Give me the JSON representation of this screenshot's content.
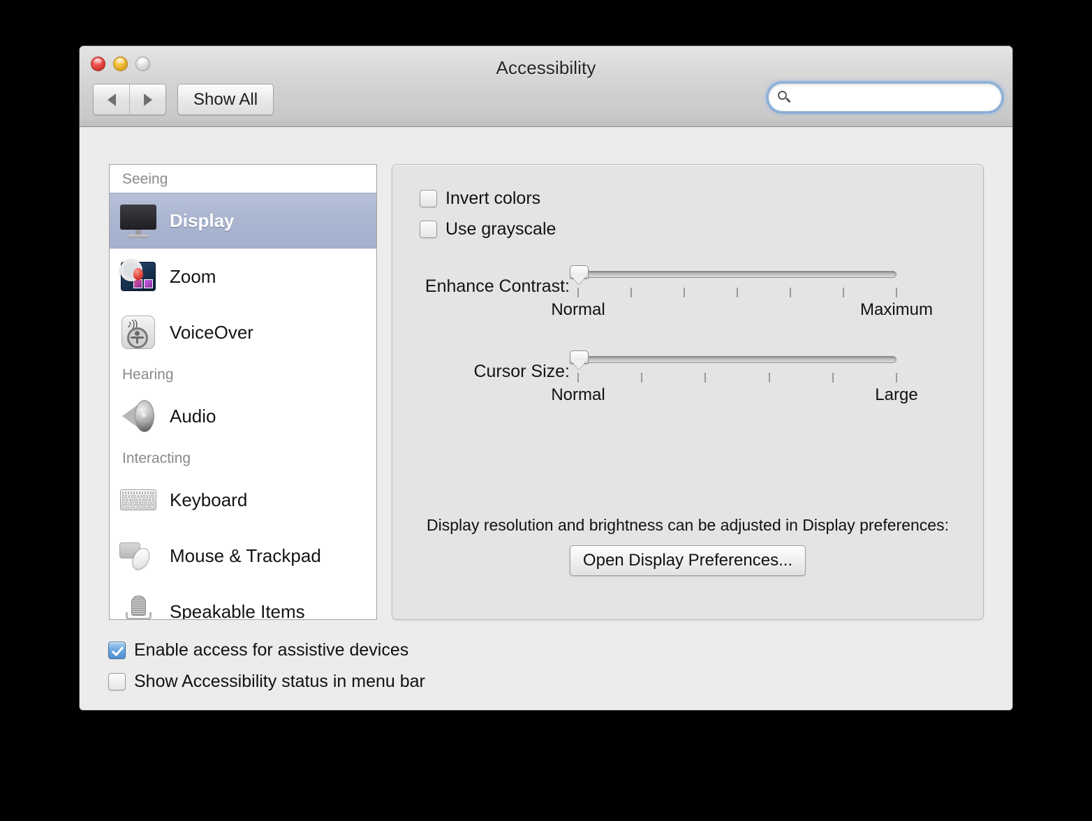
{
  "window": {
    "title": "Accessibility",
    "traffic_lights": [
      "close",
      "minimize",
      "zoom"
    ]
  },
  "toolbar": {
    "back_label": "◀",
    "forward_label": "▶",
    "show_all_label": "Show All",
    "search": {
      "value": "",
      "placeholder": "",
      "icon": "search-icon"
    }
  },
  "sidebar": {
    "items": [
      {
        "type": "group",
        "label": "Seeing"
      },
      {
        "type": "item",
        "label": "Display",
        "icon": "display-icon",
        "selected": true
      },
      {
        "type": "item",
        "label": "Zoom",
        "icon": "zoom-icon",
        "selected": false
      },
      {
        "type": "item",
        "label": "VoiceOver",
        "icon": "voiceover-icon",
        "selected": false
      },
      {
        "type": "group",
        "label": "Hearing"
      },
      {
        "type": "item",
        "label": "Audio",
        "icon": "audio-speaker-icon",
        "selected": false
      },
      {
        "type": "group",
        "label": "Interacting"
      },
      {
        "type": "item",
        "label": "Keyboard",
        "icon": "keyboard-icon",
        "selected": false
      },
      {
        "type": "item",
        "label": "Mouse & Trackpad",
        "icon": "mouse-trackpad-icon",
        "selected": false
      },
      {
        "type": "item",
        "label": "Speakable Items",
        "icon": "microphone-icon",
        "selected": false
      }
    ]
  },
  "panel": {
    "invert_colors": {
      "label": "Invert colors",
      "checked": false
    },
    "use_grayscale": {
      "label": "Use grayscale",
      "checked": false
    },
    "enhance_contrast": {
      "label": "Enhance Contrast:",
      "min_label": "Normal",
      "max_label": "Maximum",
      "value": 0,
      "min": 0,
      "max": 100,
      "tick_count": 7
    },
    "cursor_size": {
      "label": "Cursor Size:",
      "min_label": "Normal",
      "max_label": "Large",
      "value": 0,
      "min": 0,
      "max": 100,
      "tick_count": 6
    },
    "note": "Display resolution and brightness can be adjusted in Display preferences:",
    "open_display_prefs_label": "Open Display Preferences..."
  },
  "footer": {
    "enable_assistive": {
      "label": "Enable access for assistive devices",
      "checked": true
    },
    "show_status": {
      "label": "Show Accessibility status in menu bar",
      "checked": false
    },
    "help_label": "?"
  },
  "colors": {
    "selection": "#aab5d0",
    "checkbox_checked": "#4f8fd0",
    "window_bg": "#ececec",
    "panel_bg": "#e4e4e4"
  }
}
